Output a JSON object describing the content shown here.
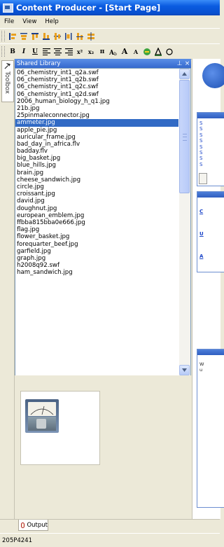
{
  "window": {
    "title": "Content Producer - [Start Page]"
  },
  "menu": {
    "items": [
      "File",
      "View",
      "Help"
    ]
  },
  "toolbar2": {
    "bold": "B",
    "italic": "I",
    "underline": "U",
    "superscript": "x²",
    "subscript": "x₂",
    "pi": "π",
    "grow_font": "A",
    "shrink_font": "A"
  },
  "toolbox": {
    "label": "Toolbox"
  },
  "shared_library": {
    "title": "Shared Library",
    "pin": "⊥",
    "close": "×",
    "selected_item": "ammeter.jpg",
    "items": [
      "06_chemistry_int1_q2a.swf",
      "06_chemistry_int1_q2b.swf",
      "06_chemistry_int1_q2c.swf",
      "06_chemistry_int1_q2d.swf",
      "2006_human_biology_h_q1.jpg",
      "21b.jpg",
      "25pinmaleconnector.jpg",
      "ammeter.jpg",
      "apple_pie.jpg",
      "auricular_frame.jpg",
      "bad_day_in_africa.flv",
      "badday.flv",
      "big_basket.jpg",
      "blue_hills.jpg",
      "brain.jpg",
      "cheese_sandwich.jpg",
      "circle.jpg",
      "croissant.jpg",
      "david.jpg",
      "doughnut.jpg",
      "european_emblem.jpg",
      "ffbba815bba0e666.jpg",
      "flag.jpg",
      "flower_basket.jpg",
      "forequarter_beef.jpg",
      "garfield.jpg",
      "graph.jpg",
      "h2008q92.swf",
      "ham_sandwich.jpg"
    ]
  },
  "start_page": {
    "box1_links": [
      "S",
      "S",
      "S",
      "S",
      "S",
      "S",
      "S",
      "S"
    ],
    "box2_links": [
      "C",
      "U",
      "A"
    ],
    "box3_text": [
      "W",
      "u"
    ]
  },
  "output": {
    "tab_label": "Output"
  },
  "status": {
    "text": "205P4241"
  }
}
